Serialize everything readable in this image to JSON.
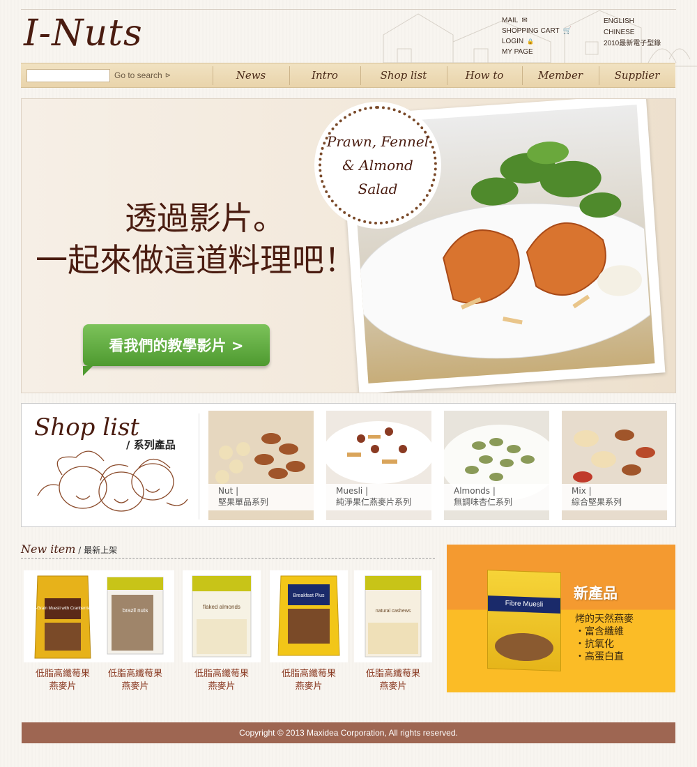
{
  "header": {
    "logo": "I-Nuts",
    "util_links": [
      {
        "label": "MAIL",
        "icon": "mail-icon"
      },
      {
        "label": "SHOPPING CART",
        "icon": "cart-icon"
      },
      {
        "label": "LOGIN",
        "icon": "lock-icon"
      },
      {
        "label": "MY PAGE"
      }
    ],
    "lang_links": [
      "ENGLISH",
      "CHINESE",
      "2010最新電子型錄"
    ]
  },
  "nav": {
    "search_placeholder": "",
    "search_label": "Go to search",
    "items": [
      "News",
      "Intro",
      "Shop list",
      "How to",
      "Member",
      "Supplier"
    ]
  },
  "hero": {
    "line1": "透過影片。",
    "line2": "一起來做這道料理吧！",
    "button": "看我們的教學影片 >",
    "badge_line1": "Prawn, Fennel",
    "badge_line2": "& Almond",
    "badge_line3": "Salad"
  },
  "shop": {
    "title": "Shop list",
    "subtitle": "/ 系列產品",
    "categories": [
      {
        "name": "Nut |",
        "desc": "堅果單品系列"
      },
      {
        "name": "Muesli |",
        "desc": "純淨果仁燕麥片系列"
      },
      {
        "name": "Almonds |",
        "desc": "無調味杏仁系列"
      },
      {
        "name": "Mix |",
        "desc": "綜合堅果系列"
      }
    ]
  },
  "new_items": {
    "title": "New item",
    "subtitle": " / 最新上架",
    "products": [
      {
        "line1": "低脂高纖莓果",
        "line2": "燕麥片",
        "pack": "5-Grain Muesli with Cranberries"
      },
      {
        "line1": "低脂高纖莓果",
        "line2": "燕麥片",
        "pack": "brazil nuts"
      },
      {
        "line1": "低脂高纖莓果",
        "line2": "燕麥片",
        "pack": "flaked almonds"
      },
      {
        "line1": "低脂高纖莓果",
        "line2": "燕麥片",
        "pack": "Breakfast Plus"
      },
      {
        "line1": "低脂高纖莓果",
        "line2": "燕麥片",
        "pack": "natural cashews"
      }
    ]
  },
  "promo": {
    "title": "新產品",
    "box_label": "Fibre Muesli",
    "lines": [
      "烤的天然燕麥",
      "・富含纖維",
      "・抗氧化",
      "・高蛋白直"
    ]
  },
  "footer": {
    "copyright": "Copyright © 2013 Maxidea Corporation, All rights reserved."
  }
}
